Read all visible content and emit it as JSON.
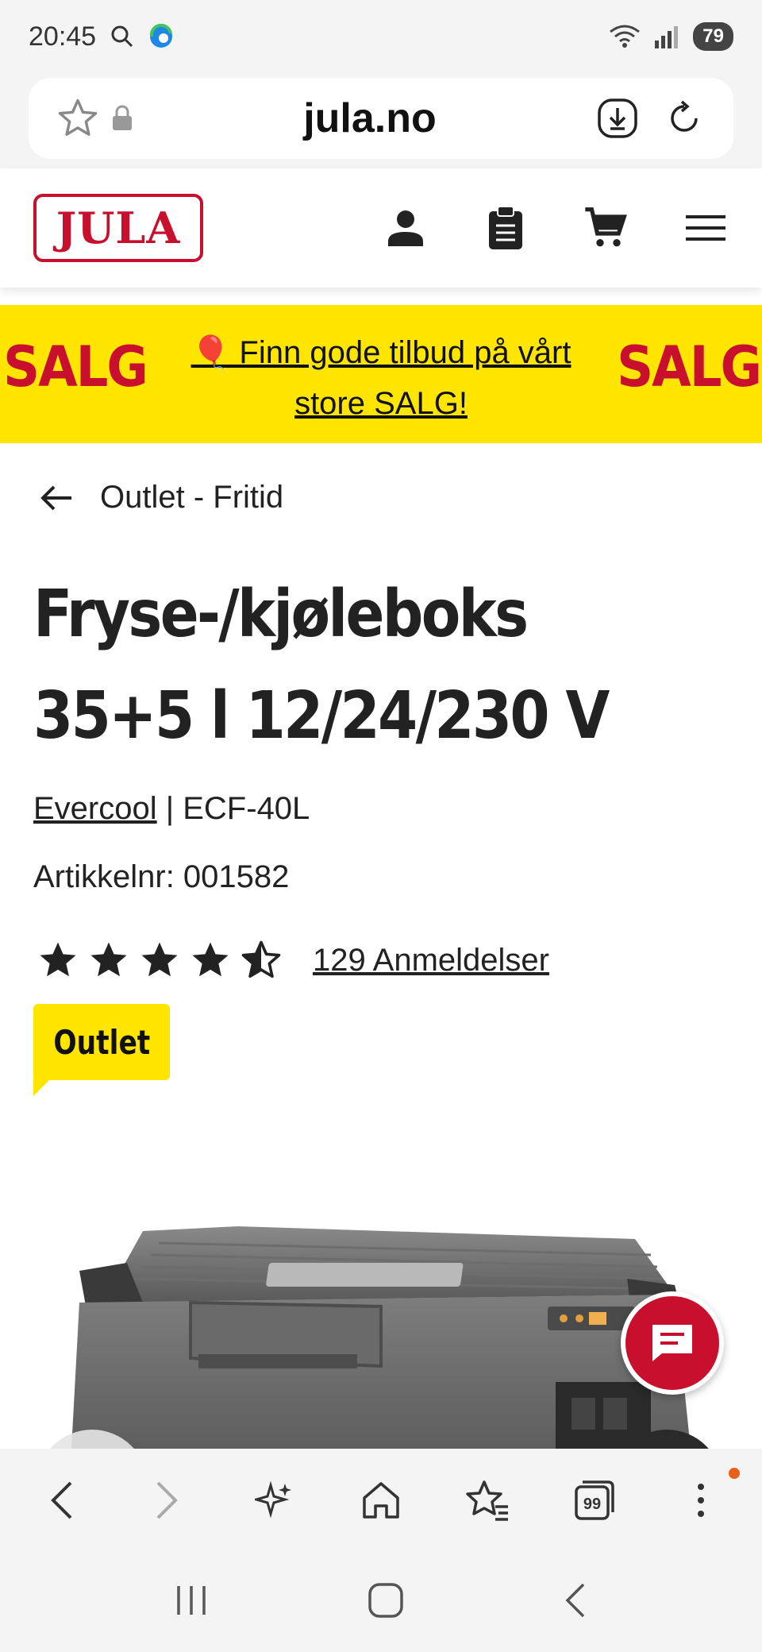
{
  "status_bar": {
    "time": "20:45",
    "battery": "79",
    "icons": [
      "search-icon",
      "edge-icon",
      "wifi-icon",
      "signal-icon"
    ]
  },
  "browser": {
    "url": "jula.no",
    "icons": [
      "star-icon",
      "lock-icon",
      "download-icon",
      "reload-icon"
    ]
  },
  "header": {
    "logo_text": "JULA",
    "brand_color": "#c8102e",
    "icons": [
      "account-icon",
      "clipboard-icon",
      "cart-icon",
      "menu-icon"
    ]
  },
  "banner": {
    "sale_left": "SALG",
    "sale_right": "SALG",
    "link_text": "🎈 Finn gode tilbud på vårt store SALG!",
    "background": "#ffe500"
  },
  "breadcrumb": {
    "label": "Outlet - Fritid"
  },
  "product": {
    "title": "Fryse-/kjøleboks 35+5 l 12/24/230 V",
    "brand": "Evercool",
    "model": " | ECF-40L",
    "article": "Artikkelnr: 001582",
    "rating_value": 4.5,
    "rating_max": 5,
    "reviews": "129 Anmeldelser",
    "badge": "Outlet"
  },
  "browser_toolbar": {
    "icons": [
      "back-icon",
      "forward-icon",
      "ai-sparkle-icon",
      "home-icon",
      "bookmarks-icon",
      "tabs-icon",
      "more-icon"
    ],
    "tabs_count": "99"
  }
}
